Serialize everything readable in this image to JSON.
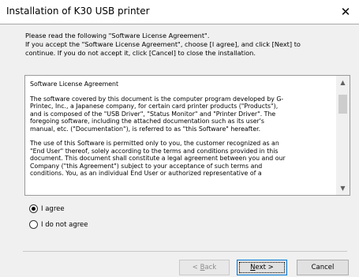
{
  "window": {
    "title": "Installation of K30 USB printer",
    "close_glyph": "✕"
  },
  "intro": {
    "lines": [
      "Please read the following \"Software License Agreement\".",
      "If you accept the \"Software License Agreement\", choose [I agree], and click [Next] to",
      "continue.  If you do not accept it, click [Cancel] to close the installation."
    ]
  },
  "license": {
    "lines": [
      "Software License Agreement",
      "",
      "The software covered by this document is the computer program developed by G-",
      "Printec, Inc., a Japanese company, for certain card printer products (\"Products\"),",
      "and is composed of the \"USB Driver\", \"Status Monitor\" and \"Printer Driver\".  The",
      "foregoing software, including the attached documentation such as its user's",
      "manual, etc. (\"Documentation\"), is referred to as \"this Software\" hereafter.",
      "",
      "The use of this Software is permitted only to you, the customer recognized as an",
      "\"End User\" thereof, solely according to the terms and conditions provided in this",
      "document.  This document shall constitute a legal agreement between you and our",
      "Company (\"this Agreement\") subject to your acceptance of such terms and",
      "conditions.  You, as an individual End User or authorized representative of a"
    ],
    "scroll_up_glyph": "▲",
    "scroll_down_glyph": "▼"
  },
  "options": {
    "agree_label": "I agree",
    "disagree_label": "I do not agree",
    "selected": "agree"
  },
  "buttons": {
    "back_key": "B",
    "back_rest": "ack",
    "back_prefix": "< ",
    "next_key": "N",
    "next_rest": "ext >",
    "cancel": "Cancel"
  }
}
